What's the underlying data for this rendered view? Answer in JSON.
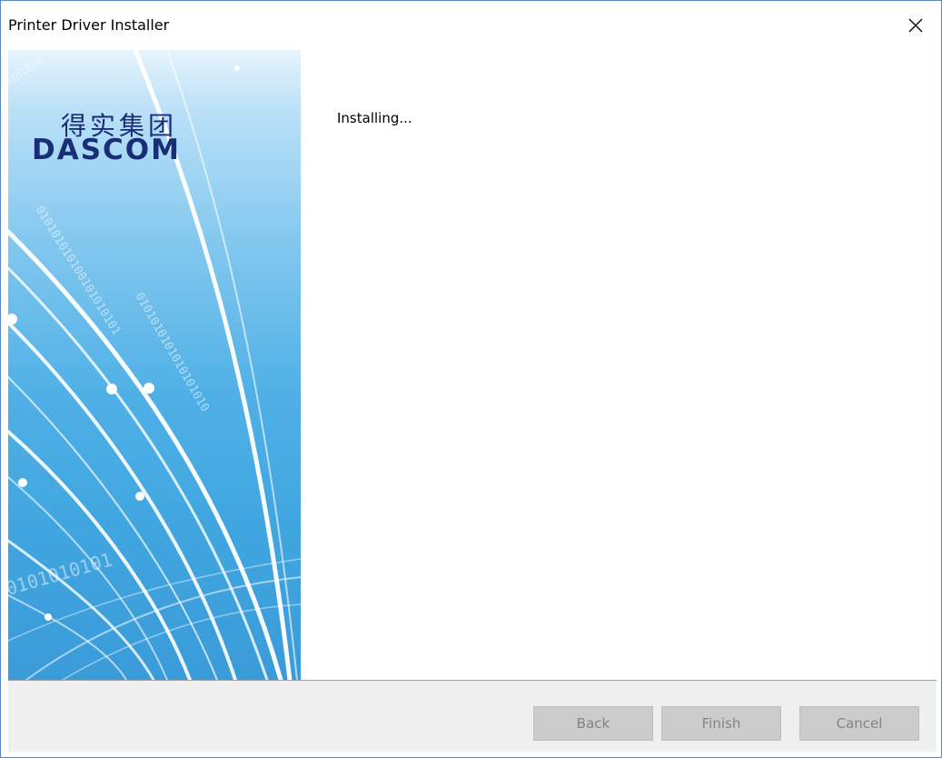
{
  "window": {
    "title": "Printer Driver Installer"
  },
  "banner": {
    "logo_chinese": "得实集团",
    "logo_english": "DASCOM"
  },
  "content": {
    "status_text": "Installing..."
  },
  "footer": {
    "back_label": "Back",
    "finish_label": "Finish",
    "cancel_label": "Cancel"
  },
  "colors": {
    "window_border": "#5b87c5",
    "banner_blue": "#4fb0e6",
    "logo_navy": "#1a2e78",
    "logo_accent_red": "#d8242a",
    "footer_bg": "#f0f0f0",
    "disabled_button_bg": "#cccccc",
    "disabled_button_text": "#838383"
  },
  "icons": {
    "close": "close-icon"
  }
}
